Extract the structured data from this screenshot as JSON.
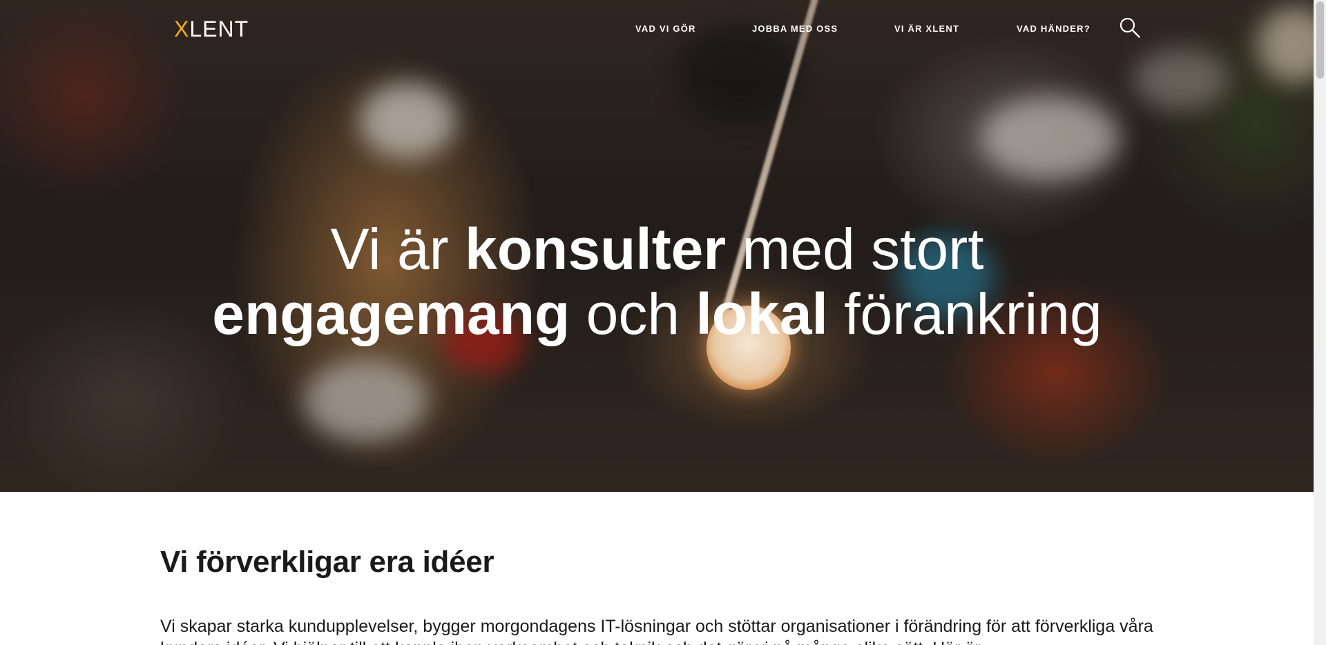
{
  "header": {
    "logo_x": "X",
    "logo_rest": "LENT",
    "nav": [
      {
        "label": "VAD VI GÖR"
      },
      {
        "label": "JOBBA MED OSS"
      },
      {
        "label": "VI ÄR XLENT"
      },
      {
        "label": "VAD HÄNDER?"
      }
    ],
    "search_icon": "search-icon"
  },
  "hero": {
    "line1_a": "Vi är ",
    "line1_b": "konsulter",
    "line1_c": " med stort",
    "line2_a": "engagemang",
    "line2_b": " och ",
    "line2_c": "lokal",
    "line2_d": " förankring"
  },
  "section": {
    "title": "Vi förverkligar era idéer",
    "body": "Vi skapar starka kundupplevelser, bygger morgondagens IT-lösningar och stöttar organisationer i förändring för att förverkliga våra kunders idéer. Vi hjälper till att koppla ihop verksamhet och teknik och det gör vi på många olika sätt. Här är"
  },
  "colors": {
    "accent": "#f2b01e",
    "text": "#1a1a1a"
  }
}
